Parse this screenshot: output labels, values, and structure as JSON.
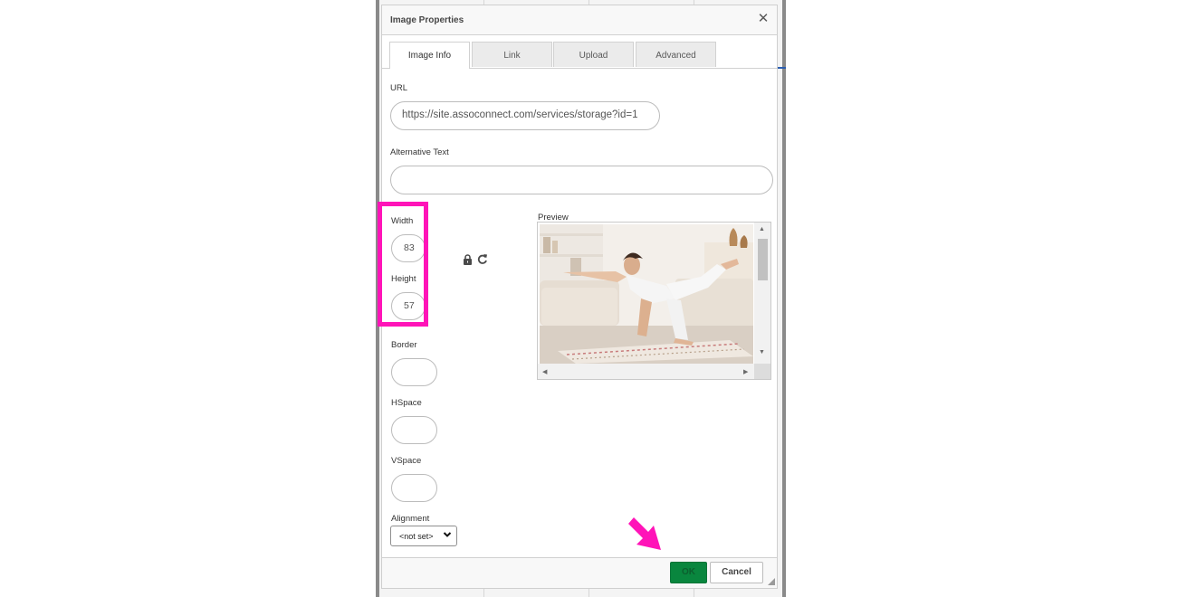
{
  "dialog": {
    "title": "Image Properties",
    "close_symbol": "✕",
    "tabs": [
      {
        "label": "Image Info",
        "active": true
      },
      {
        "label": "Link",
        "active": false
      },
      {
        "label": "Upload",
        "active": false
      },
      {
        "label": "Advanced",
        "active": false
      }
    ],
    "url": {
      "label": "URL",
      "value": "https://site.assoconnect.com/services/storage?id=1"
    },
    "alt_text": {
      "label": "Alternative Text",
      "value": ""
    },
    "width": {
      "label": "Width",
      "value": "83"
    },
    "height": {
      "label": "Height",
      "value": "57"
    },
    "border": {
      "label": "Border",
      "value": ""
    },
    "hspace": {
      "label": "HSpace",
      "value": ""
    },
    "vspace": {
      "label": "VSpace",
      "value": ""
    },
    "alignment": {
      "label": "Alignment",
      "value": "<not set>"
    },
    "preview": {
      "label": "Preview",
      "image": "woman-yoga-pose-photo"
    },
    "buttons": {
      "ok": "OK",
      "cancel": "Cancel"
    }
  },
  "annotations": {
    "highlight_color": "#ff14b8",
    "arrow_color": "#ff14b8"
  },
  "colors": {
    "ok_button": "#09863e"
  }
}
